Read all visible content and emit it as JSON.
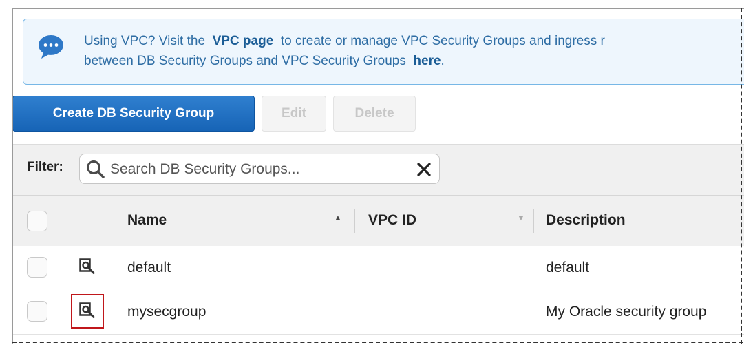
{
  "info_banner": {
    "prefix": "Using VPC? Visit the",
    "vpc_link": "VPC page",
    "middle": "to create or manage VPC Security Groups and ingress r",
    "line2_prefix": "between DB Security Groups and VPC Security Groups",
    "here_link": "here",
    "line2_suffix": "."
  },
  "toolbar": {
    "create_label": "Create DB Security Group",
    "edit_label": "Edit",
    "delete_label": "Delete"
  },
  "filter": {
    "label": "Filter:",
    "placeholder": "Search DB Security Groups..."
  },
  "table": {
    "columns": [
      "Name",
      "VPC ID",
      "Description"
    ],
    "sort_indicators": [
      "▲",
      "▼"
    ],
    "rows": [
      {
        "name": "default",
        "vpc_id": "",
        "description": "default"
      },
      {
        "name": "mysecgroup",
        "vpc_id": "",
        "description": "My Oracle security group"
      }
    ]
  },
  "colors": {
    "primary": "#1764b6",
    "info_bg": "#eef6fd",
    "info_border": "#77b7e6",
    "highlight": "#c0171b"
  },
  "icons": [
    "chat-bubble-icon",
    "search-icon",
    "clear-icon",
    "details-icon"
  ]
}
